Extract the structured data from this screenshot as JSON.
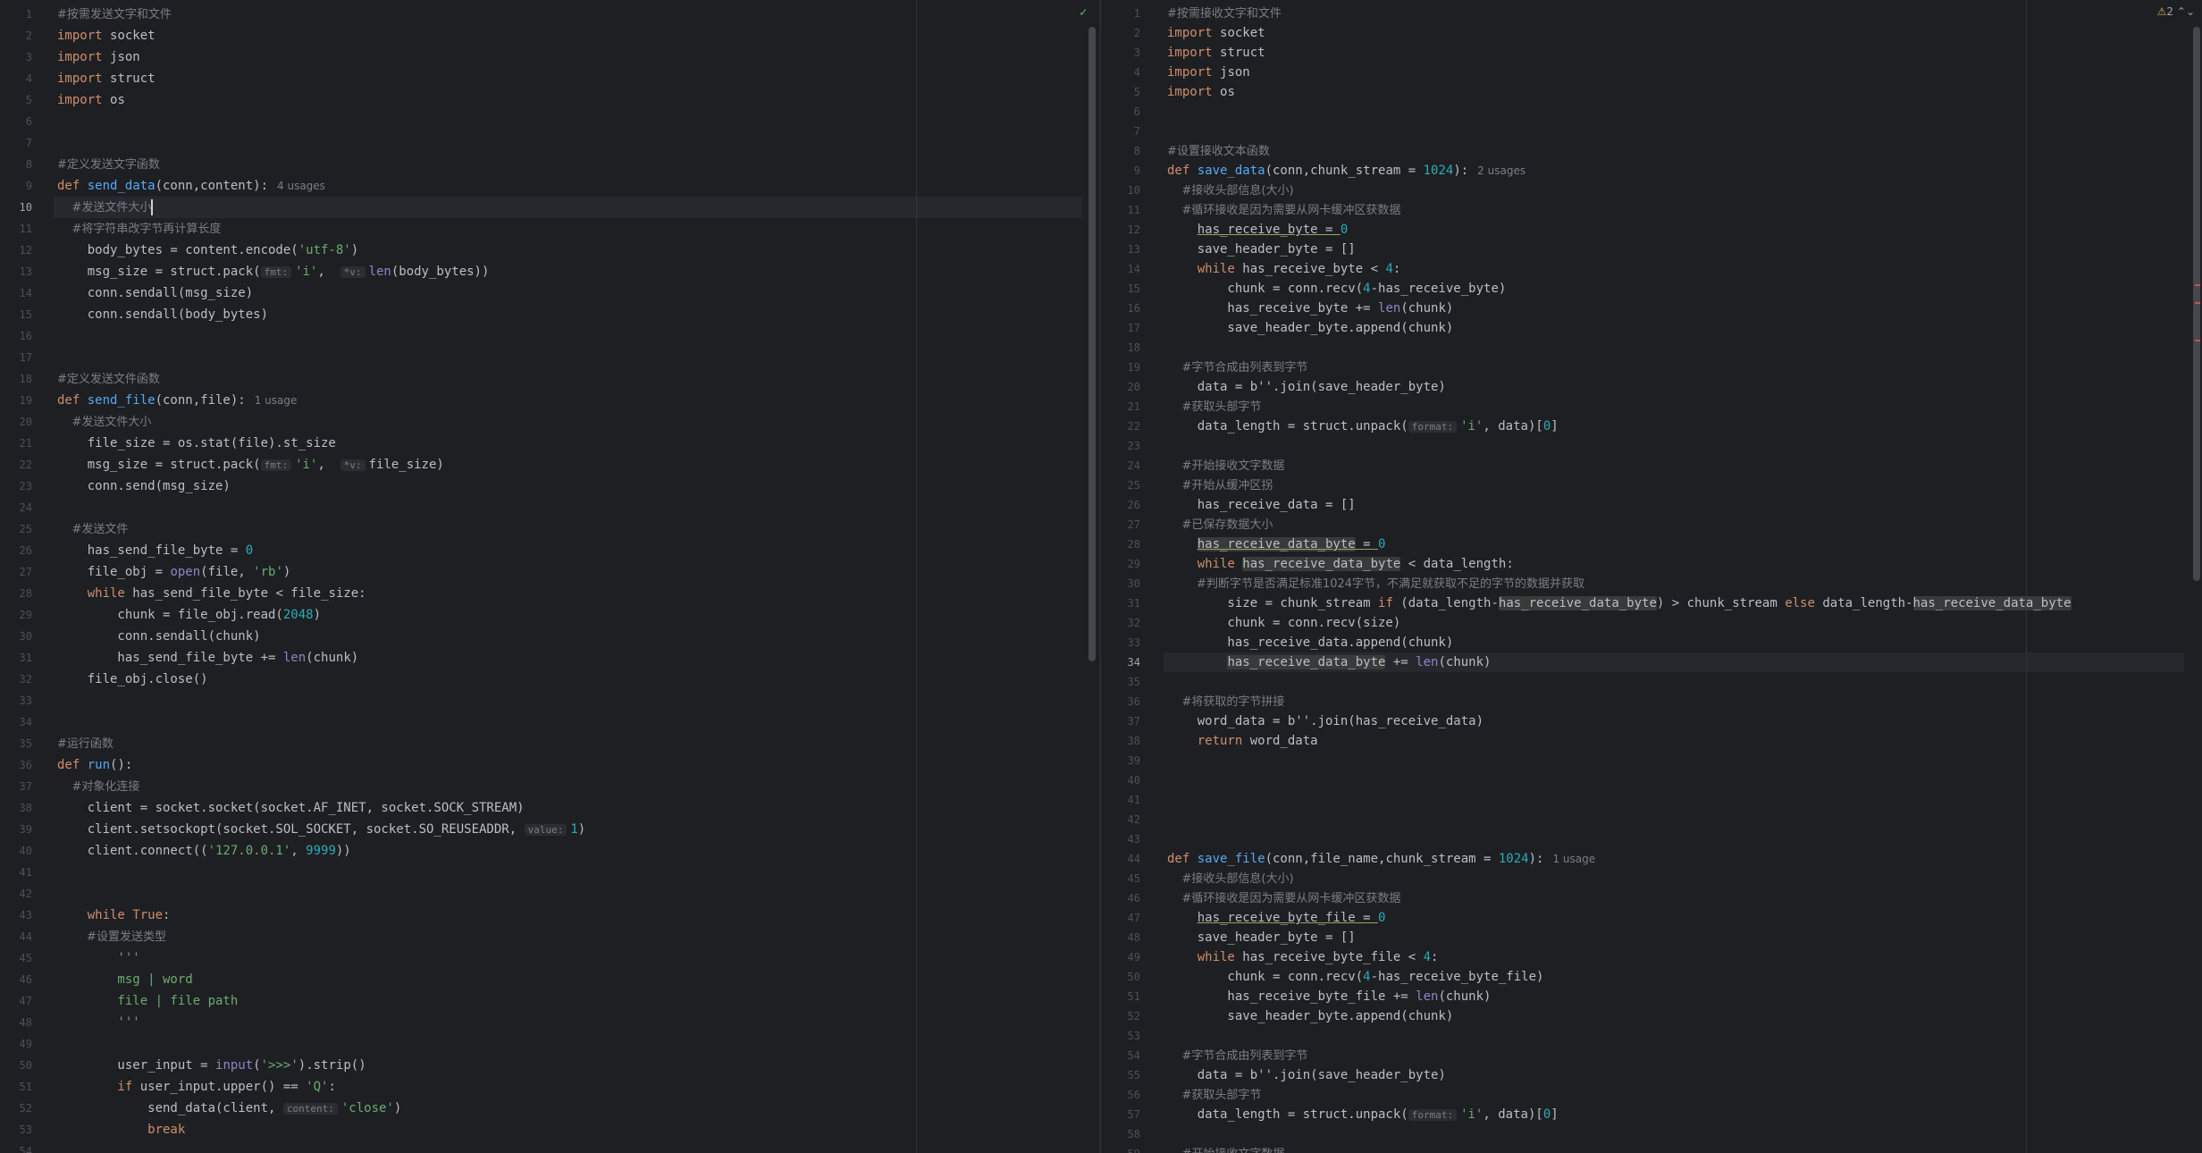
{
  "left_editor": {
    "lines": [
      [
        [
          "cm",
          "#按需发送文字和文件"
        ]
      ],
      [
        [
          "kw",
          "import"
        ],
        [
          "",
          "socket"
        ]
      ],
      [
        [
          "kw",
          "import"
        ],
        [
          "",
          "json"
        ]
      ],
      [
        [
          "kw",
          "import"
        ],
        [
          "",
          "struct"
        ]
      ],
      [
        [
          "kw",
          "import"
        ],
        [
          "",
          "os"
        ]
      ],
      [],
      [],
      [
        [
          "cm",
          "#定义发送文字函数"
        ]
      ],
      [
        [
          "kw",
          "def"
        ],
        [
          "fn",
          "send_data"
        ],
        [
          "",
          "(conn,content):"
        ],
        [
          "usage",
          "4 usages"
        ]
      ],
      [
        [
          "cm",
          "    #发送文件大小"
        ],
        [
          "caret",
          ""
        ]
      ],
      [
        [
          "cm",
          "    #将字符串改字节再计算长度"
        ]
      ],
      [
        [
          "",
          "    body_bytes = content.encode("
        ],
        [
          "str",
          "'utf-8'"
        ],
        [
          "",
          ")"
        ]
      ],
      [
        [
          "",
          "    msg_size = struct.pack("
        ],
        [
          "hint",
          "fmt:"
        ],
        [
          "str",
          "'i'"
        ],
        [
          "",
          ",  "
        ],
        [
          "hint",
          "*v:"
        ],
        [
          "bi",
          "len"
        ],
        [
          "",
          "(body_bytes))"
        ]
      ],
      [
        [
          "",
          "    conn.sendall(msg_size)"
        ]
      ],
      [
        [
          "",
          "    conn.sendall(body_bytes)"
        ]
      ],
      [],
      [],
      [
        [
          "cm",
          "#定义发送文件函数"
        ]
      ],
      [
        [
          "kw",
          "def"
        ],
        [
          "fn",
          "send_file"
        ],
        [
          "",
          "(conn,file):"
        ],
        [
          "usage",
          "1 usage"
        ]
      ],
      [
        [
          "cm",
          "    #发送文件大小"
        ]
      ],
      [
        [
          "",
          "    file_size = os.stat(file).st_size"
        ]
      ],
      [
        [
          "",
          "    msg_size = struct.pack("
        ],
        [
          "hint",
          "fmt:"
        ],
        [
          "str",
          "'i'"
        ],
        [
          "",
          ",  "
        ],
        [
          "hint",
          "*v:"
        ],
        [
          "",
          "file_size)"
        ]
      ],
      [
        [
          "",
          "    conn.send(msg_size)"
        ]
      ],
      [],
      [
        [
          "cm",
          "    #发送文件"
        ]
      ],
      [
        [
          "",
          "    has_send_file_byte = "
        ],
        [
          "num",
          "0"
        ]
      ],
      [
        [
          "",
          "    file_obj = "
        ],
        [
          "bi",
          "open"
        ],
        [
          "",
          "(file, "
        ],
        [
          "str",
          "'rb'"
        ],
        [
          "",
          ")"
        ]
      ],
      [
        [
          "kw",
          "    while"
        ],
        [
          "",
          "has_send_file_byte < file_size:"
        ]
      ],
      [
        [
          "",
          "        chunk = file_obj.read("
        ],
        [
          "num",
          "2048"
        ],
        [
          "",
          ")"
        ]
      ],
      [
        [
          "",
          "        conn.sendall(chunk)"
        ]
      ],
      [
        [
          "",
          "        has_send_file_byte += "
        ],
        [
          "bi",
          "len"
        ],
        [
          "",
          "(chunk)"
        ]
      ],
      [
        [
          "",
          "    file_obj.close()"
        ]
      ],
      [],
      [],
      [
        [
          "cm",
          "#运行函数"
        ]
      ],
      [
        [
          "kw",
          "def"
        ],
        [
          "fn",
          "run"
        ],
        [
          "",
          "():"
        ]
      ],
      [
        [
          "cm",
          "    #对象化连接"
        ]
      ],
      [
        [
          "",
          "    client = socket.socket(socket.AF_INET, socket.SOCK_STREAM)"
        ]
      ],
      [
        [
          "",
          "    client.setsockopt(socket.SOL_SOCKET, socket.SO_REUSEADDR, "
        ],
        [
          "hint",
          "value:"
        ],
        [
          "num",
          "1"
        ],
        [
          "",
          ")"
        ]
      ],
      [
        [
          "",
          "    client.connect(("
        ],
        [
          "str",
          "'127.0.0.1'"
        ],
        [
          "",
          ", "
        ],
        [
          "num",
          "9999"
        ],
        [
          "",
          "))"
        ]
      ],
      [],
      [],
      [
        [
          "kw",
          "    while"
        ],
        [
          "kw",
          "True"
        ],
        [
          "",
          ":"
        ]
      ],
      [
        [
          "cm",
          "        #设置发送类型"
        ]
      ],
      [
        [
          "str",
          "        '''"
        ]
      ],
      [
        [
          "str",
          "        msg | word"
        ]
      ],
      [
        [
          "str",
          "        file | file path"
        ]
      ],
      [
        [
          "str",
          "        '''"
        ]
      ],
      [],
      [
        [
          "",
          "        user_input = "
        ],
        [
          "bi",
          "input"
        ],
        [
          "",
          "("
        ],
        [
          "str",
          "'>>>'"
        ],
        [
          "",
          ").strip()"
        ]
      ],
      [
        [
          "kw",
          "        if"
        ],
        [
          "",
          "user_input.upper() == "
        ],
        [
          "str",
          "'Q'"
        ],
        [
          "",
          ":"
        ]
      ],
      [
        [
          "",
          "            send_data(client, "
        ],
        [
          "hint",
          "content:"
        ],
        [
          "str",
          "'close'"
        ],
        [
          "",
          ")"
        ]
      ],
      [
        [
          "kw",
          "            break"
        ]
      ],
      []
    ]
  },
  "right_editor": {
    "lines": [
      [
        [
          "cm",
          "#按需接收文字和文件"
        ]
      ],
      [
        [
          "kw",
          "import"
        ],
        [
          "",
          "socket"
        ]
      ],
      [
        [
          "kw",
          "import"
        ],
        [
          "",
          "struct"
        ]
      ],
      [
        [
          "kw",
          "import"
        ],
        [
          "",
          "json"
        ]
      ],
      [
        [
          "kw",
          "import"
        ],
        [
          "",
          "os"
        ]
      ],
      [],
      [],
      [
        [
          "cm",
          "#设置接收文本函数"
        ]
      ],
      [
        [
          "kw",
          "def"
        ],
        [
          "fn",
          "save_data"
        ],
        [
          "",
          "(conn,chunk_stream = "
        ],
        [
          "num",
          "1024"
        ],
        [
          "",
          "):"
        ],
        [
          "usage",
          "2 usages"
        ]
      ],
      [
        [
          "cm",
          "    #接收头部信息(大小)"
        ]
      ],
      [
        [
          "cm",
          "    #循环接收是因为需要从网卡缓冲区获数据"
        ]
      ],
      [
        [
          "",
          "    "
        ],
        [
          "ul",
          "has_receive_byte = "
        ],
        [
          "num",
          "0"
        ]
      ],
      [
        [
          "",
          "    save_header_byte = []"
        ]
      ],
      [
        [
          "kw",
          "    while"
        ],
        [
          "",
          "has_receive_byte < "
        ],
        [
          "num",
          "4"
        ],
        [
          "",
          ":"
        ]
      ],
      [
        [
          "",
          "        chunk = conn.recv("
        ],
        [
          "num",
          "4"
        ],
        [
          "",
          "-has_receive_byte)"
        ]
      ],
      [
        [
          "",
          "        has_receive_byte += "
        ],
        [
          "bi",
          "len"
        ],
        [
          "",
          "(chunk)"
        ]
      ],
      [
        [
          "",
          "        save_header_byte.append(chunk)"
        ]
      ],
      [],
      [
        [
          "cm",
          "    #字节合成由列表到字节"
        ]
      ],
      [
        [
          "",
          "    data = b''.join(save_header_byte)"
        ]
      ],
      [
        [
          "cm",
          "    #获取头部字节"
        ]
      ],
      [
        [
          "",
          "    data_length = struct.unpack("
        ],
        [
          "hint",
          "format:"
        ],
        [
          "str",
          "'i'"
        ],
        [
          "",
          ", data)["
        ],
        [
          "num",
          "0"
        ],
        [
          "",
          "]"
        ]
      ],
      [],
      [
        [
          "cm",
          "    #开始接收文字数据"
        ]
      ],
      [
        [
          "cm",
          "    #开始从缓冲区拐"
        ]
      ],
      [
        [
          "",
          "    has_receive_data = []"
        ]
      ],
      [
        [
          "cm",
          "    #已保存数据大小"
        ]
      ],
      [
        [
          "",
          "    "
        ],
        [
          "hlul",
          "has_receive_data_byte"
        ],
        [
          "",
          ""
        ],
        [
          "ul",
          " = "
        ],
        [
          "num",
          "0"
        ]
      ],
      [
        [
          "kw",
          "    while"
        ],
        [
          "hl",
          "has_receive_data_byte"
        ],
        [
          "",
          " < data_length:"
        ]
      ],
      [
        [
          "cm",
          "        #判断字节是否满足标准1024字节，不满足就获取不足的字节的数据并获取"
        ]
      ],
      [
        [
          "",
          "        size = chunk_stream "
        ],
        [
          "kw",
          "if"
        ],
        [
          "",
          " (data_length-"
        ],
        [
          "hl",
          "has_receive_data_byte"
        ],
        [
          "",
          ") > chunk_stream "
        ],
        [
          "kw",
          "else"
        ],
        [
          "",
          " data_length-"
        ],
        [
          "hl",
          "has_receive_data_byte"
        ]
      ],
      [
        [
          "",
          "        chunk = conn.recv(size)"
        ]
      ],
      [
        [
          "",
          "        has_receive_data.append(chunk)"
        ]
      ],
      [
        [
          "",
          "        "
        ],
        [
          "hl",
          "has_receive_data_byte"
        ],
        [
          "",
          " += "
        ],
        [
          "bi",
          "len"
        ],
        [
          "",
          "(chunk)"
        ]
      ],
      [],
      [
        [
          "cm",
          "    #将获取的字节拼接"
        ]
      ],
      [
        [
          "",
          "    word_data = b''.join(has_receive_data)"
        ]
      ],
      [
        [
          "kw",
          "    return"
        ],
        [
          "",
          "word_data"
        ]
      ],
      [],
      [],
      [],
      [],
      [],
      [
        [
          "kw",
          "def"
        ],
        [
          "fn",
          "save_file"
        ],
        [
          "",
          "(conn,file_name,chunk_stream = "
        ],
        [
          "num",
          "1024"
        ],
        [
          "",
          "):"
        ],
        [
          "usage",
          "1 usage"
        ]
      ],
      [
        [
          "cm",
          "    #接收头部信息(大小)"
        ]
      ],
      [
        [
          "cm",
          "    #循环接收是因为需要从网卡缓冲区获数据"
        ]
      ],
      [
        [
          "",
          "    "
        ],
        [
          "ul",
          "has_receive_byte_file = "
        ],
        [
          "num",
          "0"
        ]
      ],
      [
        [
          "",
          "    save_header_byte = []"
        ]
      ],
      [
        [
          "kw",
          "    while"
        ],
        [
          "",
          "has_receive_byte_file < "
        ],
        [
          "num",
          "4"
        ],
        [
          "",
          ":"
        ]
      ],
      [
        [
          "",
          "        chunk = conn.recv("
        ],
        [
          "num",
          "4"
        ],
        [
          "",
          "-has_receive_byte_file)"
        ]
      ],
      [
        [
          "",
          "        has_receive_byte_file += "
        ],
        [
          "bi",
          "len"
        ],
        [
          "",
          "(chunk)"
        ]
      ],
      [
        [
          "",
          "        save_header_byte.append(chunk)"
        ]
      ],
      [],
      [
        [
          "cm",
          "    #字节合成由列表到字节"
        ]
      ],
      [
        [
          "",
          "    data = b''.join(save_header_byte)"
        ]
      ],
      [
        [
          "cm",
          "    #获取头部字节"
        ]
      ],
      [
        [
          "",
          "    data_length = struct.unpack("
        ],
        [
          "hint",
          "format:"
        ],
        [
          "str",
          "'i'"
        ],
        [
          "",
          ", data)["
        ],
        [
          "num",
          "0"
        ],
        [
          "",
          "]"
        ]
      ],
      [],
      [
        [
          "cm",
          "    #开始接收文字数据"
        ]
      ]
    ]
  },
  "inspections": {
    "warning_count": "2"
  },
  "colors": {
    "background": "#1e1f22",
    "keyword": "#cf8e6d",
    "function": "#56a8f5",
    "string": "#6aab73",
    "number": "#2aacb8",
    "comment": "#7a7e85"
  }
}
